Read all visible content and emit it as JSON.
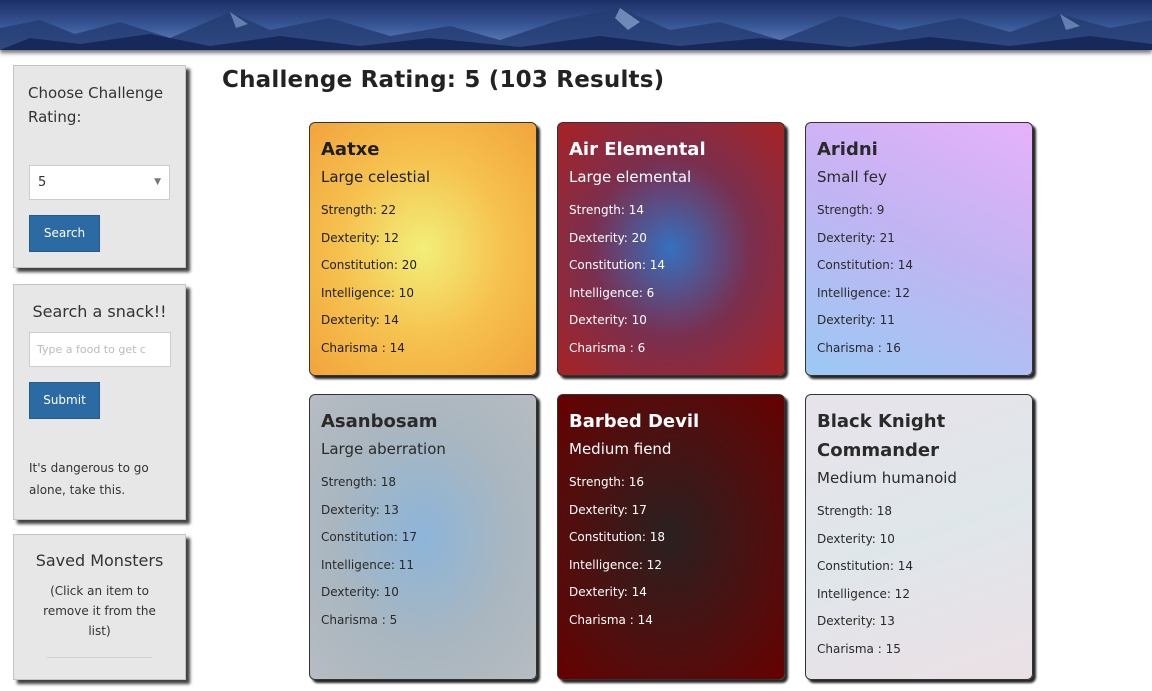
{
  "sidebar": {
    "challenge_panel": {
      "title": "Choose Challenge Rating:",
      "selected_value": "5",
      "search_label": "Search"
    },
    "snack_panel": {
      "title": "Search a snack!!",
      "placeholder": "Type a food to get c",
      "submit_label": "Submit",
      "note": "It's dangerous to go alone, take this."
    },
    "saved_panel": {
      "title": "Saved Monsters",
      "subtitle": "(Click an item to remove it from the list)"
    }
  },
  "main": {
    "heading": "Challenge Rating: 5 (103 Results)"
  },
  "cards": [
    {
      "name": "Aatxe",
      "type": "Large celestial",
      "stats": [
        "Strength: 22",
        "Dexterity: 12",
        "Constitution: 20",
        "Intelligence: 10",
        "Dexterity: 14",
        "Charisma : 14"
      ]
    },
    {
      "name": "Air Elemental",
      "type": "Large elemental",
      "stats": [
        "Strength: 14",
        "Dexterity: 20",
        "Constitution: 14",
        "Intelligence: 6",
        "Dexterity: 10",
        "Charisma : 6"
      ]
    },
    {
      "name": "Aridni",
      "type": "Small fey",
      "stats": [
        "Strength: 9",
        "Dexterity: 21",
        "Constitution: 14",
        "Intelligence: 12",
        "Dexterity: 11",
        "Charisma : 16"
      ]
    },
    {
      "name": "Asanbosam",
      "type": "Large aberration",
      "stats": [
        "Strength: 18",
        "Dexterity: 13",
        "Constitution: 17",
        "Intelligence: 11",
        "Dexterity: 10",
        "Charisma : 5"
      ]
    },
    {
      "name": "Barbed Devil",
      "type": "Medium fiend",
      "stats": [
        "Strength: 16",
        "Dexterity: 17",
        "Constitution: 18",
        "Intelligence: 12",
        "Dexterity: 14",
        "Charisma : 14"
      ]
    },
    {
      "name": "Black Knight Commander",
      "type": "Medium humanoid",
      "stats": [
        "Strength: 18",
        "Dexterity: 10",
        "Constitution: 14",
        "Intelligence: 12",
        "Dexterity: 13",
        "Charisma : 15"
      ]
    }
  ],
  "colors": {
    "button": "#2c6aa3",
    "panel_bg": "#e7e7e7"
  }
}
